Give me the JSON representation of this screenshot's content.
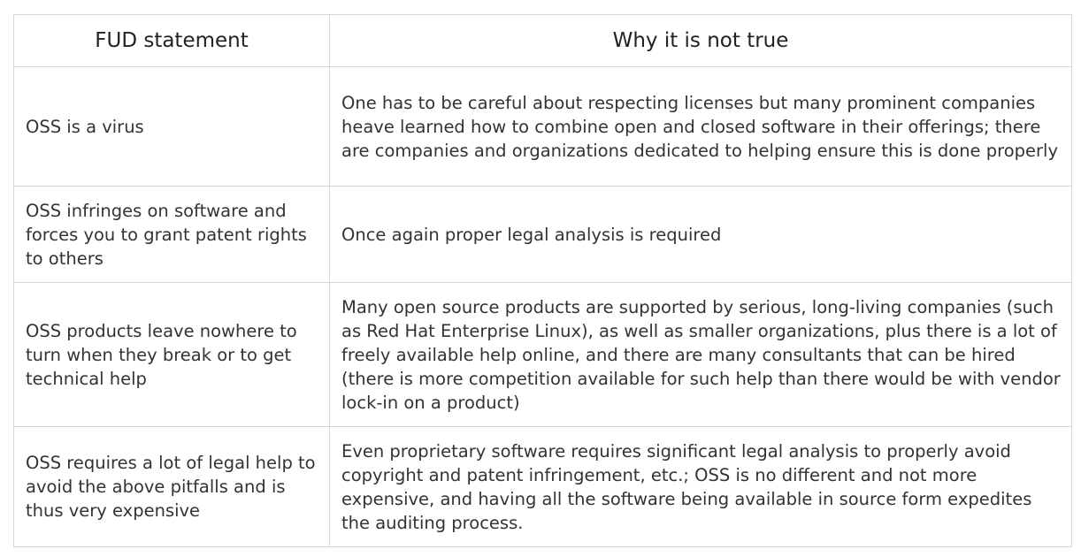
{
  "table": {
    "headers": [
      "FUD statement",
      "Why it is not true"
    ],
    "rows": [
      {
        "statement": "OSS is a virus",
        "rebuttal": "One has to be careful about respecting licenses but many prominent companies heave learned how to combine open and closed software in their offerings; there are companies and organizations dedicated to helping ensure this is done properly"
      },
      {
        "statement": "OSS infringes on software and forces you to grant patent rights to others",
        "rebuttal": "Once again proper legal analysis is required"
      },
      {
        "statement": "OSS products leave nowhere to turn when they break or to get technical help",
        "rebuttal": "Many open source products are supported by serious, long-living companies (such as Red Hat Enterprise Linux), as well as smaller organizations, plus there is a lot of freely available help online, and there are many consultants that can be hired (there is more competition available for such help than there would be with vendor lock-in on a product)"
      },
      {
        "statement": "OSS requires a lot of legal help to avoid the above pitfalls and is thus very expensive",
        "rebuttal": "Even proprietary software requires significant legal analysis to properly avoid copyright and patent infringement, etc.; OSS is no different and not more expensive, and having all the software being available in source form expedites the auditing process."
      }
    ]
  }
}
